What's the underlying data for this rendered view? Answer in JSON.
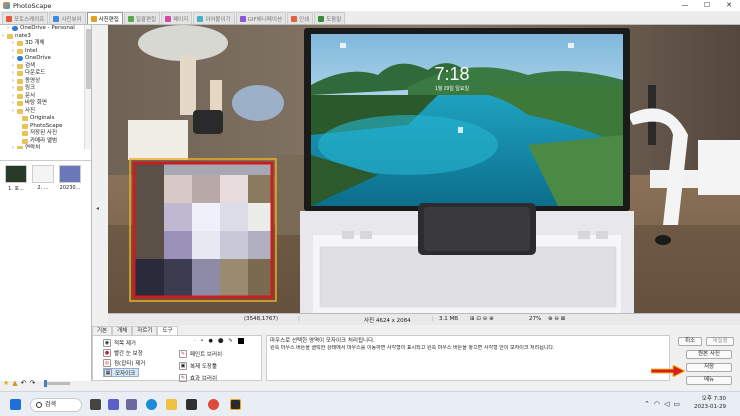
{
  "window": {
    "title": "PhotoScape",
    "controls": [
      "—",
      "☐",
      "✕"
    ]
  },
  "tabs": [
    {
      "label": "포토스케이프",
      "color": "#e05b3a"
    },
    {
      "label": "사진뷰어",
      "color": "#3c8be0"
    },
    {
      "label": "사진편집",
      "color": "#e0a020",
      "active": true
    },
    {
      "label": "일괄편집",
      "color": "#5aa84a"
    },
    {
      "label": "페이지",
      "color": "#d04aa0"
    },
    {
      "label": "이어붙이기",
      "color": "#4ab0c8"
    },
    {
      "label": "GIF애니메이션",
      "color": "#8a5ad0"
    },
    {
      "label": "인쇄",
      "color": "#e06040"
    },
    {
      "label": "도움말",
      "color": "#3a8a3a"
    }
  ],
  "tree": [
    {
      "label": "OneDrive - Personal",
      "icon": "onedrive-icon",
      "indent": 1
    },
    {
      "label": "nate3",
      "icon": "folder-icon",
      "indent": 0
    },
    {
      "label": "3D 개체",
      "icon": "folder-icon",
      "indent": 2
    },
    {
      "label": "Intel",
      "icon": "folder-icon",
      "indent": 2
    },
    {
      "label": "OneDrive",
      "icon": "onedrive-icon",
      "indent": 2
    },
    {
      "label": "검색",
      "icon": "folder-icon",
      "indent": 2
    },
    {
      "label": "다운로드",
      "icon": "folder-icon",
      "indent": 2
    },
    {
      "label": "동영상",
      "icon": "folder-icon",
      "indent": 2
    },
    {
      "label": "링크",
      "icon": "folder-icon",
      "indent": 2
    },
    {
      "label": "문서",
      "icon": "folder-icon",
      "indent": 2
    },
    {
      "label": "바탕 화면",
      "icon": "folder-icon",
      "indent": 2
    },
    {
      "label": "사진",
      "icon": "folder-icon",
      "indent": 2
    },
    {
      "label": "Originals",
      "icon": "folder-icon",
      "indent": 3
    },
    {
      "label": "PhotoScape",
      "icon": "folder-icon",
      "indent": 3
    },
    {
      "label": "저장된 사진",
      "icon": "folder-icon",
      "indent": 3
    },
    {
      "label": "카메라 앨범",
      "icon": "folder-icon",
      "indent": 3
    },
    {
      "label": "연락처",
      "icon": "folder-icon",
      "indent": 2
    }
  ],
  "thumbnails": [
    {
      "label": "1. 포...",
      "color": "#2a3a2a"
    },
    {
      "label": "2. ...",
      "color": "#f4f4f4"
    },
    {
      "label": "20230...",
      "color": "#6a78b8"
    }
  ],
  "status": {
    "coords": "(3548,1767)",
    "size": "사진 4624 x 2084",
    "filesize": "3.1 MB",
    "zoom": "27%"
  },
  "bottom_tabs": [
    "기본",
    "개체",
    "자르기",
    "도구"
  ],
  "tools": {
    "red_eye": "적목 제거",
    "mole": "점(잡티) 제거",
    "redeye_fix": "빨간 눈 보정",
    "mosaic": "모자이크",
    "paint_brush": "페인트 브러쉬",
    "clone_stamp": "복제 도장툴",
    "effect_brush": "효과 브러쉬"
  },
  "message": {
    "line1": "마우스로 선택한 영역이 모자이크 처리됩니다.",
    "line2": "왼쪽 마우스 버튼을 클릭한 상태에서 마우스를 이동하면 사각형이 표시되고 왼쪽 마우스 버튼을 놓으면 사각형 안이 모자이크 처리됩니다."
  },
  "right_buttons": {
    "cancel": "취소",
    "redo": "재실행",
    "original": "원본 사진",
    "save": "저장",
    "menu": "메뉴"
  },
  "laptop_clock": {
    "time": "7:18",
    "date": "1월 29일 일요일"
  },
  "taskbar": {
    "search": "검색",
    "time": "오후 7:30",
    "date": "2023-01-29"
  }
}
